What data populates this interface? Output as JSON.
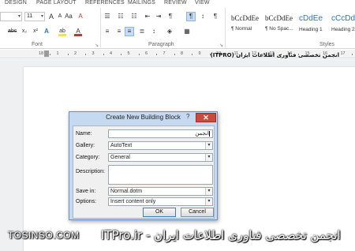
{
  "ribbon": {
    "tabs": [
      "DESIGN",
      "PAGE LAYOUT",
      "REFERENCES",
      "MAILINGS",
      "REVIEW",
      "VIEW"
    ],
    "font_size": "11",
    "font_size_arrow": "▾",
    "font_glyphs": {
      "grow": "A",
      "shrink": "A",
      "case": "Aa",
      "clear": "A",
      "strike": "abc",
      "subscript": "x₂",
      "superscript": "x²",
      "effects": "A",
      "highlight": "ab",
      "color": "A"
    },
    "para_glyphs": {
      "bullets": "☰",
      "numbering": "☷",
      "multilevel": "☷",
      "decrease_indent": "⇤",
      "increase_indent": "⇥",
      "ltr": "¶",
      "rtl": "¶",
      "sort": "↕",
      "pilcrow": "¶",
      "align_left": "≡",
      "center": "≡",
      "align_right": "≡",
      "justify": "≣",
      "line_spacing": "↕",
      "shading": "◈",
      "borders": "▦"
    },
    "groups": {
      "font": "Font",
      "paragraph": "Paragraph",
      "styles": "Styles"
    },
    "dialog_launcher": "↘",
    "styles": [
      {
        "sample": "bCcDdEe",
        "name": "¶ Normal"
      },
      {
        "sample": "bCcDdEe",
        "name": "¶ No Spac..."
      },
      {
        "sample": "cDdEe",
        "name": "Heading 1"
      },
      {
        "sample": "cCcDdEe",
        "name": "Heading 2"
      }
    ]
  },
  "ruler": {
    "numbers": [
      "18",
      "1",
      "2",
      "3",
      "4",
      "5",
      "6",
      "7",
      "8",
      "9",
      "10",
      "11",
      "12",
      "13",
      "14",
      "15",
      "16",
      "17"
    ]
  },
  "document": {
    "heading": "انجمن تخصصی فناوری اطلاعات ایران (ITPRO)"
  },
  "dialog": {
    "title": "Create New Building Block",
    "help": "?",
    "close": "✕",
    "fields": [
      {
        "label": "Name:",
        "value": "انجمن"
      },
      {
        "label": "Gallery:",
        "value": "AutoText"
      },
      {
        "label": "Category:",
        "value": "General"
      },
      {
        "label": "Description:",
        "value": ""
      },
      {
        "label": "Save in:",
        "value": "Normal.dotm"
      },
      {
        "label": "Options:",
        "value": "Insert content only"
      }
    ],
    "dropdown_arrow": "▾",
    "ok": "OK",
    "cancel": "Cancel"
  },
  "watermark": {
    "left": "TOSINSO.COM",
    "right": "ITPro.ir - انجمن تخصصی فناوری اطلاعات ایران"
  },
  "colors": {
    "dialog_frame": "#c5daf1",
    "close_button": "#c74b3f",
    "heading_style": "#2e74b5",
    "highlight_yellow": "#ffeb00",
    "font_color_red": "#e8281e"
  }
}
